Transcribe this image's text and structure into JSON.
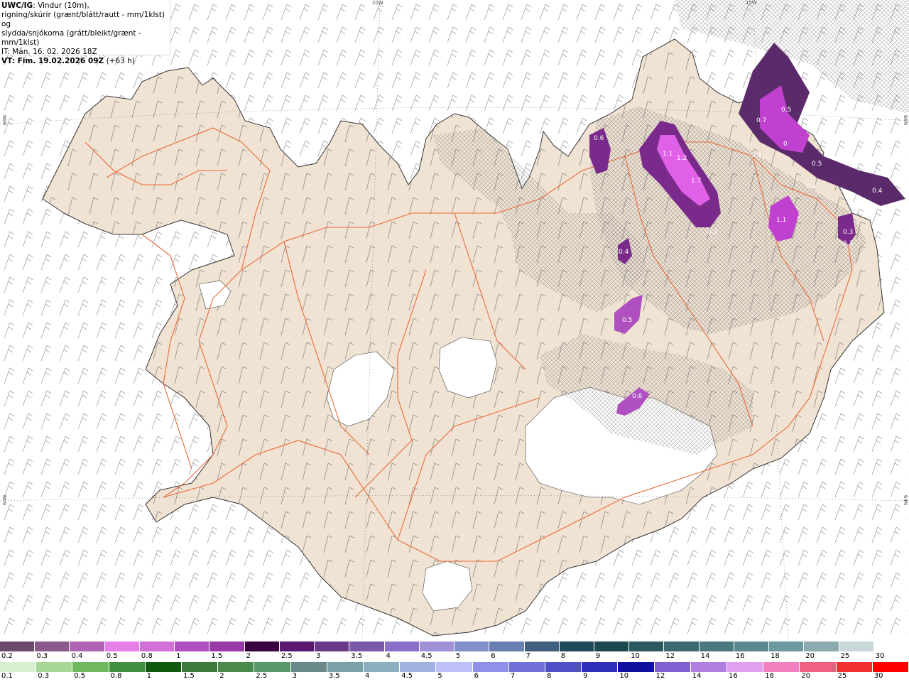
{
  "header": {
    "product": "UWC/IG",
    "line1": ": Vindur (10m),",
    "line2": "rigning/skúrir (grænt/blátt/rautt - mm/1klst) og",
    "line3": "slydda/snjókoma (grátt/bleikt/grænt - mm/1klst)",
    "it_line": "IT: Mán. 16. 02. 2026 18Z",
    "vt_bold": "VT: Fim. 19.02.2026 09Z",
    "vt_rest": " (+63 h)"
  },
  "grid_labels": {
    "lon_20w": "20W",
    "lon_15w": "15W",
    "lat_66n_left": "66N",
    "lat_66n_right": "66N",
    "lat_64n_left": "64N",
    "lat_64n_right": "64N"
  },
  "precip_labels": [
    "0.5",
    "0.7",
    "0",
    "0.3",
    "0.6",
    "1.1",
    "1.2",
    "1.7",
    "0.5",
    "0.4",
    "0.4",
    "1.1",
    "0.3",
    "0.3",
    "0.3",
    "0.4",
    "0.5",
    "0.6"
  ],
  "snow_scale": {
    "labels": [
      "0.2",
      "0.3",
      "0.4",
      "0.5",
      "0.8",
      "1",
      "1.5",
      "2",
      "2.5",
      "3",
      "3.5",
      "4",
      "4.5",
      "5",
      "6",
      "7",
      "8",
      "9",
      "10",
      "12",
      "14",
      "16",
      "18",
      "20",
      "25",
      "30"
    ],
    "colors": [
      "#6b4a6e",
      "#8a5a8c",
      "#b064b4",
      "#e680e8",
      "#d070d8",
      "#b050c0",
      "#9a3aa8",
      "#3a0040",
      "#5a1a70",
      "#6a3a88",
      "#7a5aa8",
      "#8a70c8",
      "#a090d8",
      "#8090c8",
      "#6a80b0",
      "#406080",
      "#204a5a",
      "#1a4a50",
      "#2a5a60",
      "#3a6a70",
      "#4a7a80",
      "#5a8a90",
      "#6a9aa0",
      "#8aaab0",
      "#c8d8d8",
      "#ffffff"
    ]
  },
  "rain_scale": {
    "labels": [
      "0.1",
      "0.3",
      "0.5",
      "0.8",
      "1",
      "1.5",
      "2",
      "2.5",
      "3",
      "3.5",
      "4",
      "4.5",
      "5",
      "6",
      "7",
      "8",
      "9",
      "10",
      "12",
      "14",
      "16",
      "18",
      "20",
      "25",
      "30"
    ],
    "colors": [
      "#d8f0d0",
      "#a8d898",
      "#70b860",
      "#409040",
      "#105a10",
      "#3a7a3a",
      "#4a8a4a",
      "#5a9a6a",
      "#6a8a8a",
      "#7aa0a8",
      "#8ab0c0",
      "#a0b0e0",
      "#c0c0f8",
      "#9090e8",
      "#7070d8",
      "#5050c8",
      "#3030b8",
      "#1010a0",
      "#8060d0",
      "#b080e0",
      "#e0a0f0",
      "#f080c0",
      "#f06080",
      "#f03030",
      "#ff0000"
    ]
  }
}
